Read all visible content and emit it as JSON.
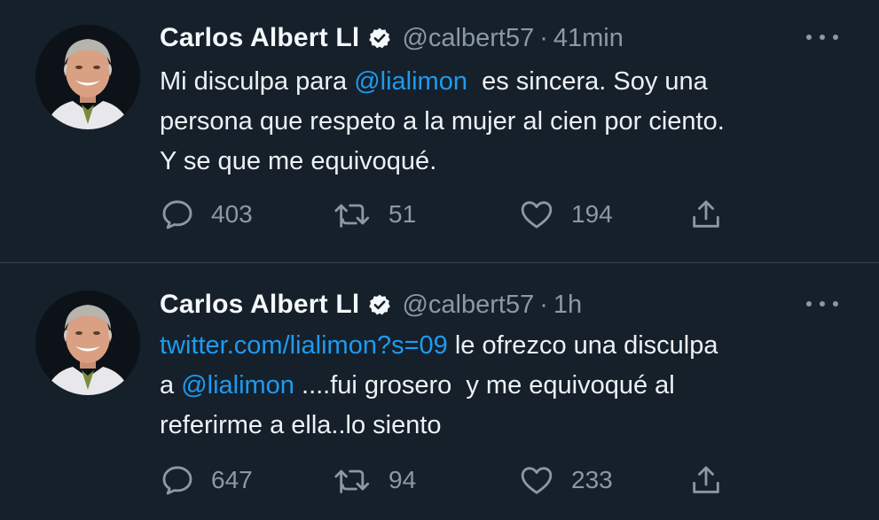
{
  "tweets": [
    {
      "author": "Carlos Albert Ll",
      "handle": "@calbert57",
      "separator": "·",
      "time": "41min",
      "lines": [
        [
          {
            "text": "Mi disculpa para ",
            "link": false
          },
          {
            "text": "@lialimon",
            "link": true
          },
          {
            "text": "  es sincera. Soy una",
            "link": false
          }
        ],
        [
          {
            "text": "persona que respeto a la mujer al cien por ciento.",
            "link": false
          }
        ],
        [
          {
            "text": "Y se que me equivoqué.",
            "link": false
          }
        ]
      ],
      "reply_count": "403",
      "retweet_count": "51",
      "like_count": "194"
    },
    {
      "author": "Carlos Albert Ll",
      "handle": "@calbert57",
      "separator": "·",
      "time": "1h",
      "lines": [
        [
          {
            "text": "twitter.com/lialimon?s=09",
            "link": true
          },
          {
            "text": " le ofrezco una disculpa",
            "link": false
          }
        ],
        [
          {
            "text": "a ",
            "link": false
          },
          {
            "text": "@lialimon",
            "link": true
          },
          {
            "text": " ....fui grosero  y me equivoqué al",
            "link": false
          }
        ],
        [
          {
            "text": "referirme a ella..lo siento",
            "link": false
          }
        ]
      ],
      "reply_count": "647",
      "retweet_count": "94",
      "like_count": "233"
    }
  ],
  "icons": {
    "verified": "verified-badge-icon",
    "more": "more-options-icon",
    "reply": "reply-icon",
    "retweet": "retweet-icon",
    "like": "like-heart-icon",
    "share": "share-icon"
  },
  "colors": {
    "background": "#15202b",
    "link": "#1d9bf0",
    "muted": "#8b98a5",
    "divider": "#38444d"
  }
}
